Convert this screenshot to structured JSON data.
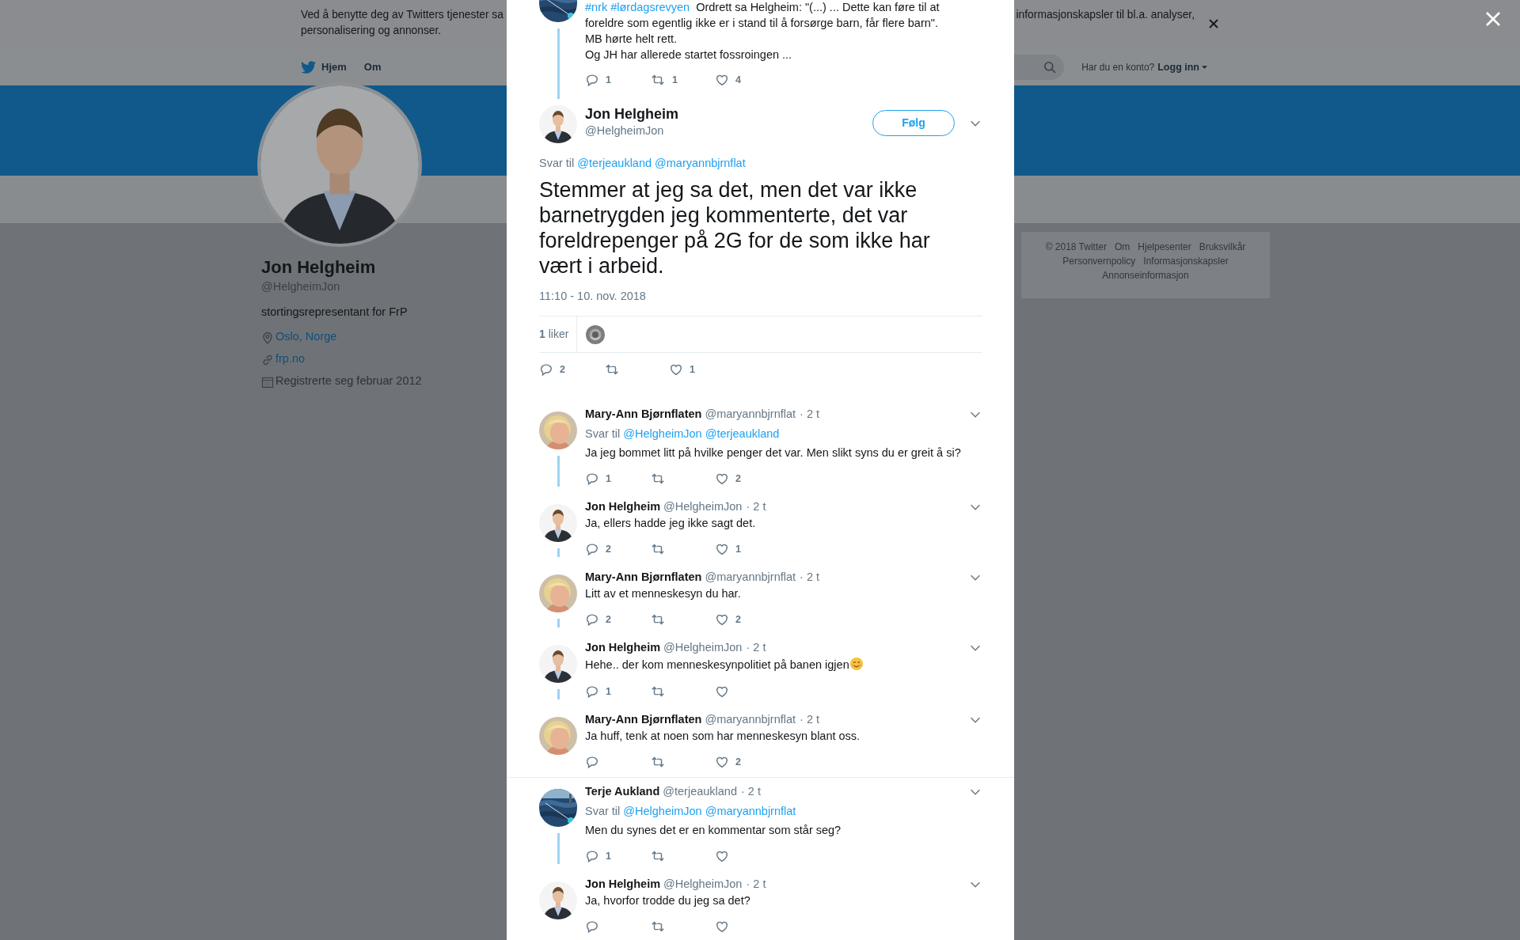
{
  "cookie_banner": {
    "line1_left": "Ved å benytte deg av Twitters tjenester sa",
    "line1_right": "informasjonskapsler til bl.a. analyser,",
    "line2": "personalisering og annonser."
  },
  "nav": {
    "items": [
      "Hjem",
      "Om"
    ],
    "account_prompt": "Har du en konto?",
    "login": "Logg inn"
  },
  "profile": {
    "name": "Jon Helgheim",
    "handle": "@HelgheimJon",
    "bio": "stortingsrepresentant for FrP",
    "location": "Oslo, Norge",
    "website": "frp.no",
    "joined": "Registrerte seg februar 2012"
  },
  "footer_rows": [
    [
      "© 2018 Twitter",
      "Om",
      "Hjelpesenter",
      "Bruksvilkår"
    ],
    [
      "Personvernpolicy",
      "Informasjonskapsler"
    ],
    [
      "Annonseinformasjon"
    ]
  ],
  "modal": {
    "parent_tweet": {
      "hashtags": [
        "#nrk",
        "#lørdagsrevyen"
      ],
      "text": "Ordrett sa Helgheim: \"(...) ... Dette kan føre til at foreldre som egentlig ikke er i stand til å forsørge barn, får flere barn\".\nMB hørte helt rett.\nOg JH har allerede startet fossroingen ...",
      "replies": "1",
      "retweets": "1",
      "likes": "4"
    },
    "main_tweet": {
      "name": "Jon Helgheim",
      "handle": "@HelgheimJon",
      "follow": "Følg",
      "reply_to_label": "Svar til",
      "mentions": [
        "@terjeaukland",
        "@maryannbjrnflat"
      ],
      "text": "Stemmer at jeg sa det, men det var ikke barnetrygden jeg kommenterte, det var foreldrepenger på 2G for de som ikke har vært i arbeid.",
      "timestamp": "11:10 - 10. nov. 2018",
      "likes_summary": "**1** liker",
      "replies": "2",
      "likes": "1"
    },
    "reply_groups": [
      {
        "tweets": [
          {
            "name": "Mary-Ann Bjørnflaten",
            "handle": "@maryannbjrnflat",
            "time": "· 2 t",
            "reply_to_label": "Svar til",
            "mentions": [
              "@HelgheimJon",
              "@terjeaukland"
            ],
            "text": "Ja jeg bommet litt på hvilke penger det var. Men slikt syns du er greit å si?",
            "replies": "1",
            "likes": "2"
          },
          {
            "name": "Jon Helgheim",
            "handle": "@HelgheimJon",
            "time": "· 2 t",
            "text": "Ja, ellers hadde jeg ikke sagt det.",
            "replies": "2",
            "likes": "1"
          },
          {
            "name": "Mary-Ann Bjørnflaten",
            "handle": "@maryannbjrnflat",
            "time": "· 2 t",
            "text": "Litt av et menneskesyn du har.",
            "replies": "2",
            "likes": "2"
          },
          {
            "name": "Jon Helgheim",
            "handle": "@HelgheimJon",
            "time": "· 2 t",
            "text": "Hehe.. der kom menneskesynpolitiet på banen igjen",
            "trailing_emoji": true,
            "replies": "1"
          },
          {
            "name": "Mary-Ann Bjørnflaten",
            "handle": "@maryannbjrnflat",
            "time": "· 2 t",
            "text": "Ja huff, tenk at noen som har menneskesyn blant oss.",
            "likes": "2"
          }
        ]
      },
      {
        "tweets": [
          {
            "name": "Terje Aukland",
            "handle": "@terjeaukland",
            "time": "· 2 t",
            "reply_to_label": "Svar til",
            "mentions": [
              "@HelgheimJon",
              "@maryannbjrnflat"
            ],
            "text": "Men du synes det er en kommentar som står seg?",
            "replies": "1"
          },
          {
            "name": "Jon Helgheim",
            "handle": "@HelgheimJon",
            "time": "· 2 t",
            "text": "Ja, hvorfor trodde du jeg sa det?"
          }
        ]
      }
    ]
  }
}
